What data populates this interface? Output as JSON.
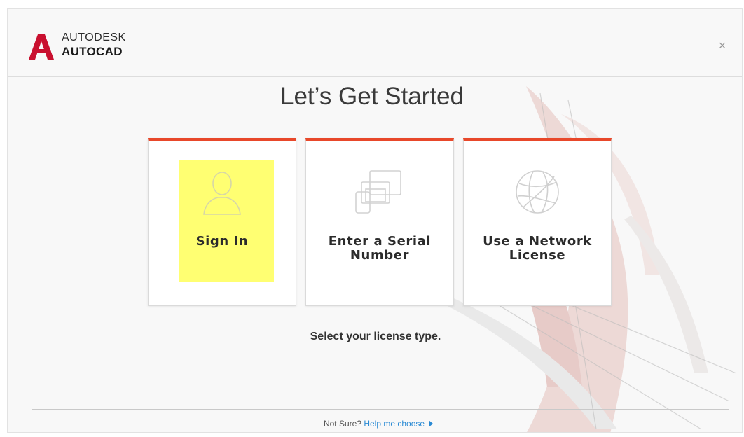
{
  "brand": {
    "line1": "AUTODESK",
    "line2": "AUTOCAD",
    "color": "#c9102f"
  },
  "window": {
    "close_icon": "×"
  },
  "main": {
    "title": "Let’s Get Started",
    "subtitle": "Select your license type.",
    "accent_color": "#e8482a",
    "highlight_color": "#ffff66"
  },
  "cards": [
    {
      "label_lines": [
        "Sign In"
      ],
      "icon": "user-silhouette-icon",
      "highlighted": true
    },
    {
      "label_lines": [
        "Enter a Serial",
        "Number"
      ],
      "icon": "devices-icon",
      "highlighted": false
    },
    {
      "label_lines": [
        "Use a Network",
        "License"
      ],
      "icon": "globe-network-icon",
      "highlighted": false
    }
  ],
  "footer": {
    "prefix": "Not Sure?",
    "link": "Help me choose"
  }
}
